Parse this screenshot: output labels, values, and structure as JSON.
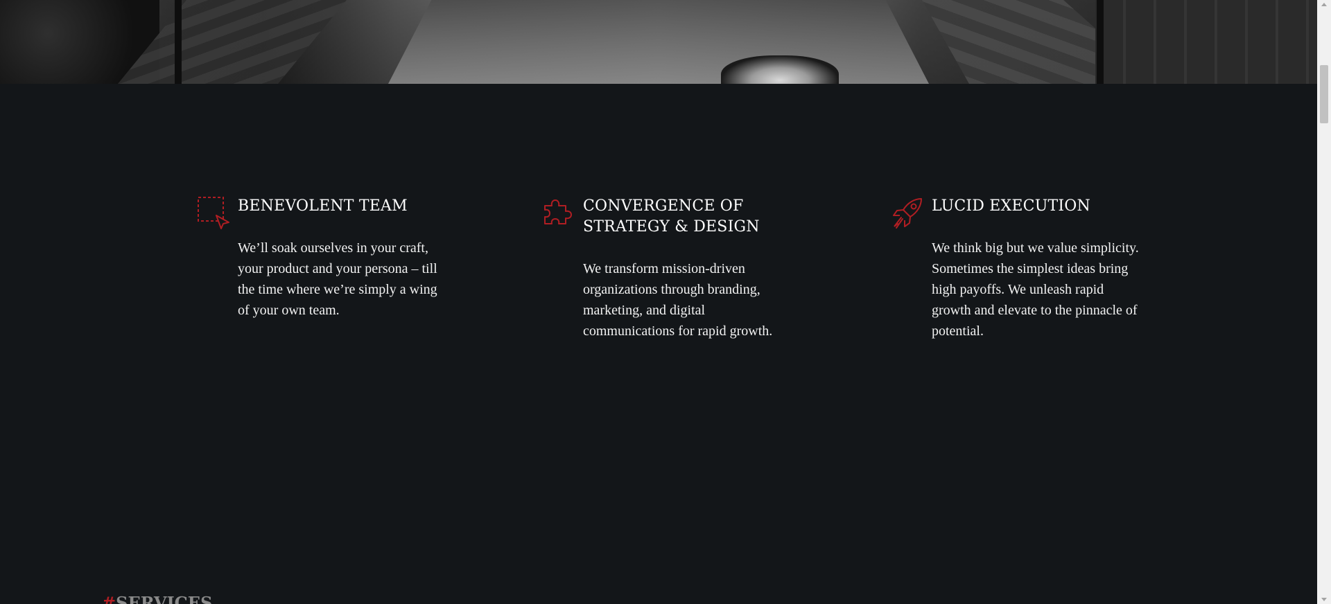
{
  "colors": {
    "background": "#131619",
    "accent": "#b01e23",
    "heading": "#ffffff",
    "body_text": "#f2f2f2",
    "section_label": "#8a8a8a"
  },
  "features": [
    {
      "icon": "selection-cursor-icon",
      "title": "BENEVOLENT TEAM",
      "text": "We’ll soak ourselves in your craft, your product and your persona – till the time where we’re simply a wing of your own team."
    },
    {
      "icon": "puzzle-piece-icon",
      "title": "CONVERGENCE OF STRATEGY & DESIGN",
      "text": "We transform mission-driven organizations through branding, marketing, and digital communications for rapid growth."
    },
    {
      "icon": "rocket-icon",
      "title": "LUCID EXECUTION",
      "text": "We think big but we value simplicity. Sometimes the simplest ideas bring high payoffs. We unleash rapid growth and elevate to the pinnacle of potential."
    }
  ],
  "services_section": {
    "hash": "#",
    "label": "SERVICES"
  }
}
